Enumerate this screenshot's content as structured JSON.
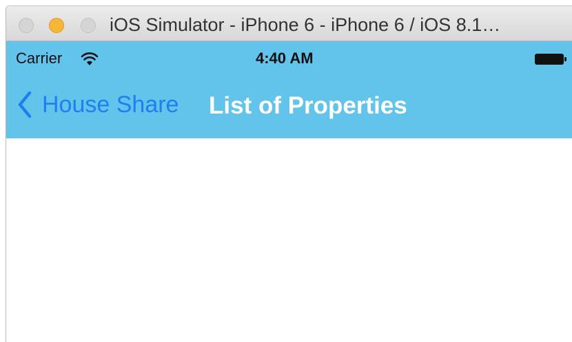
{
  "window": {
    "title": "iOS Simulator - iPhone 6 - iPhone 6 / iOS 8.1…"
  },
  "status_bar": {
    "carrier": "Carrier",
    "time": "4:40 AM",
    "wifi_icon": "wifi-icon",
    "battery_icon": "battery-icon"
  },
  "nav_bar": {
    "back_label": "House Share",
    "back_icon": "chevron-left-icon",
    "title": "List of Properties"
  },
  "colors": {
    "nav_bar_background": "#62c3eb",
    "back_button_tint": "#1f7ff0",
    "title_text": "#ffffff"
  }
}
